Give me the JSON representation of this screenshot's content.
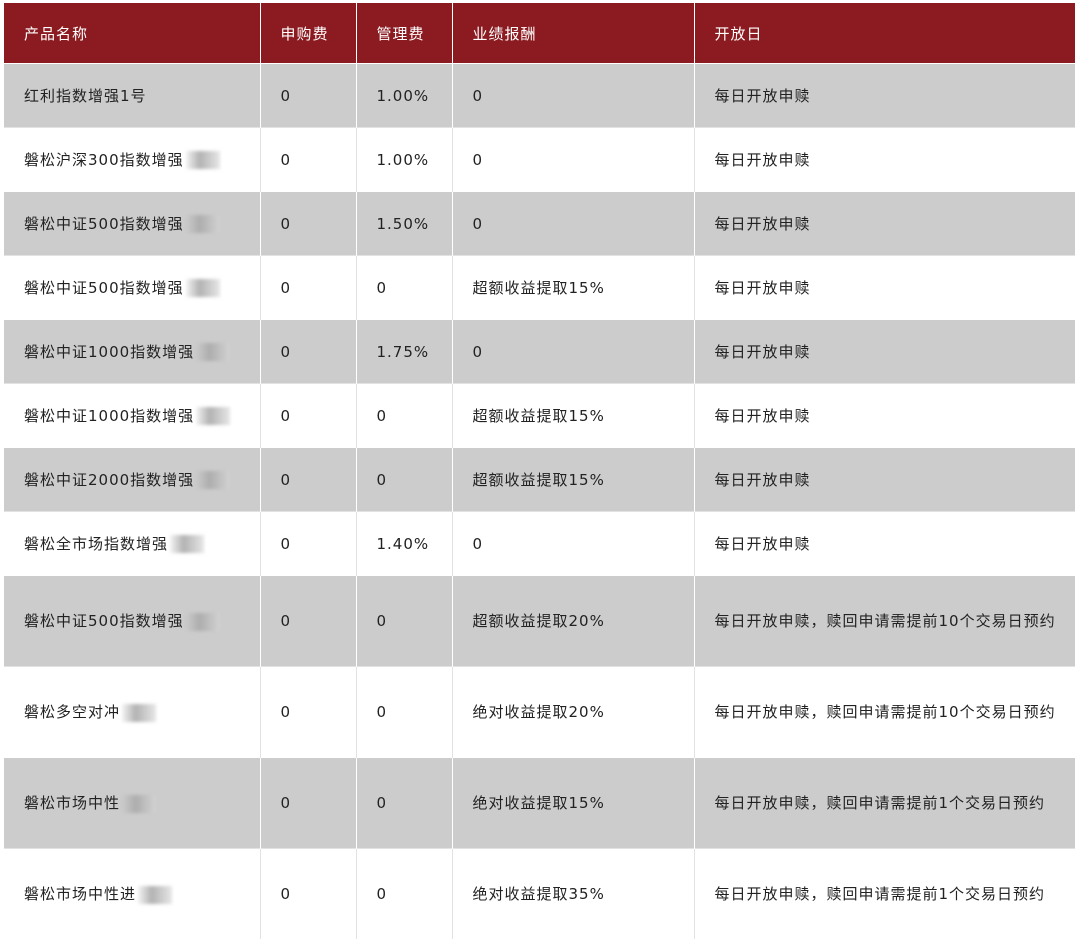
{
  "table": {
    "headers": [
      "产品名称",
      "申购费",
      "管理费",
      "业绩报酬",
      "开放日"
    ],
    "rows": [
      {
        "name": "红利指数增强1号",
        "obscured": false,
        "subscription_fee": "0",
        "management_fee": "1.00%",
        "performance_fee": "0",
        "open_day": "每日开放申赎"
      },
      {
        "name": "磐松沪深300指数增强",
        "obscured": true,
        "subscription_fee": "0",
        "management_fee": "1.00%",
        "performance_fee": "0",
        "open_day": "每日开放申赎"
      },
      {
        "name": "磐松中证500指数增强",
        "obscured": true,
        "subscription_fee": "0",
        "management_fee": "1.50%",
        "performance_fee": "0",
        "open_day": "每日开放申赎"
      },
      {
        "name": "磐松中证500指数增强",
        "obscured": true,
        "subscription_fee": "0",
        "management_fee": "0",
        "performance_fee": "超额收益提取15%",
        "open_day": "每日开放申赎"
      },
      {
        "name": "磐松中证1000指数增强",
        "obscured": true,
        "subscription_fee": "0",
        "management_fee": "1.75%",
        "performance_fee": "0",
        "open_day": "每日开放申赎"
      },
      {
        "name": "磐松中证1000指数增强",
        "obscured": true,
        "subscription_fee": "0",
        "management_fee": "0",
        "performance_fee": "超额收益提取15%",
        "open_day": "每日开放申赎"
      },
      {
        "name": "磐松中证2000指数增强",
        "obscured": true,
        "subscription_fee": "0",
        "management_fee": "0",
        "performance_fee": "超额收益提取15%",
        "open_day": "每日开放申赎"
      },
      {
        "name": "磐松全市场指数增强",
        "obscured": true,
        "subscription_fee": "0",
        "management_fee": "1.40%",
        "performance_fee": "0",
        "open_day": "每日开放申赎"
      },
      {
        "name": "磐松中证500指数增强",
        "obscured": true,
        "subscription_fee": "0",
        "management_fee": "0",
        "performance_fee": "超额收益提取20%",
        "open_day": "每日开放申赎，赎回申请需提前10个交易日预约"
      },
      {
        "name": "磐松多空对冲",
        "obscured": true,
        "subscription_fee": "0",
        "management_fee": "0",
        "performance_fee": "绝对收益提取20%",
        "open_day": "每日开放申赎，赎回申请需提前10个交易日预约"
      },
      {
        "name": "磐松市场中性",
        "obscured": true,
        "subscription_fee": "0",
        "management_fee": "0",
        "performance_fee": "绝对收益提取15%",
        "open_day": "每日开放申赎，赎回申请需提前1个交易日预约"
      },
      {
        "name": "磐松市场中性进",
        "obscured": true,
        "subscription_fee": "0",
        "management_fee": "0",
        "performance_fee": "绝对收益提取35%",
        "open_day": "每日开放申赎，赎回申请需提前1个交易日预约"
      }
    ]
  }
}
